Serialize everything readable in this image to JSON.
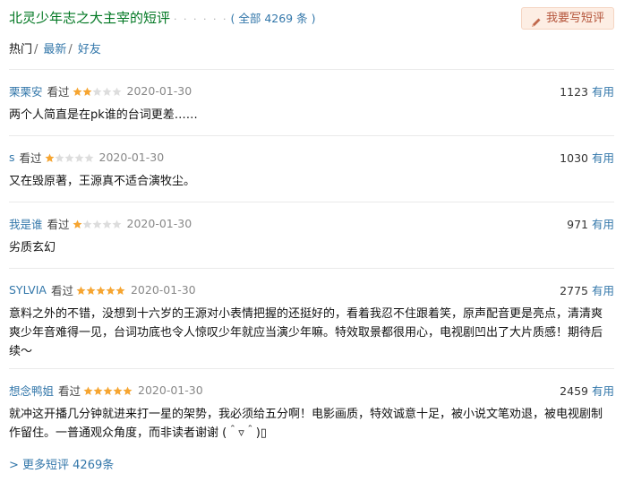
{
  "header": {
    "title": "北灵少年志之大主宰的短评",
    "dots": "· · · · · ·",
    "total_prefix": "( 全部",
    "total_count": "4269",
    "total_suffix": "条 )",
    "write_button": "我要写短评"
  },
  "tabs": [
    {
      "label": "热门",
      "sep": "/"
    },
    {
      "label": "最新",
      "sep": "/"
    },
    {
      "label": "好友",
      "sep": ""
    }
  ],
  "colors": {
    "accent": "#3377aa",
    "title_green": "#007722",
    "star_filled": "#f6a531",
    "star_empty": "#dddddd"
  },
  "reviews": [
    {
      "user": "栗栗安",
      "status": "看过",
      "rating": 2,
      "date": "2020-01-30",
      "votes": "1123",
      "useful": "有用",
      "content": "两个人简直是在pk谁的台词更差……"
    },
    {
      "user": "s",
      "status": "看过",
      "rating": 1,
      "date": "2020-01-30",
      "votes": "1030",
      "useful": "有用",
      "content": "又在毁原著，王源真不适合演牧尘。"
    },
    {
      "user": "我是谁",
      "status": "看过",
      "rating": 1,
      "date": "2020-01-30",
      "votes": "971",
      "useful": "有用",
      "content": "劣质玄幻"
    },
    {
      "user": "SYLVIA",
      "status": "看过",
      "rating": 5,
      "date": "2020-01-30",
      "votes": "2775",
      "useful": "有用",
      "content": "意料之外的不错，没想到十六岁的王源对小表情把握的还挺好的，看着我忍不住跟着笑，原声配音更是亮点，清清爽爽少年音难得一见，台词功底也令人惊叹少年就应当演少年嘛。特效取景都很用心，电视剧凹出了大片质感！期待后续～"
    },
    {
      "user": "想念鸭姐",
      "status": "看过",
      "rating": 5,
      "date": "2020-01-30",
      "votes": "2459",
      "useful": "有用",
      "content": "就冲这开播几分钟就进来打一星的架势，我必须给五分啊！电影画质，特效诚意十足，被小说文笔劝退，被电视剧制作留住。一普通观众角度，而非读者谢谢 (＾▿＾)▯"
    }
  ],
  "more_link": "> 更多短评 4269条"
}
